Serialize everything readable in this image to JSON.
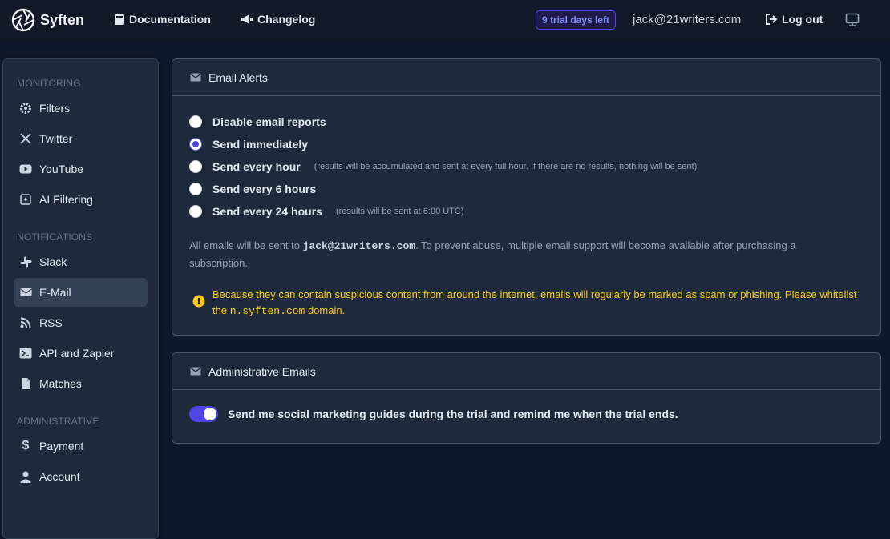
{
  "topbar": {
    "brand": "Syften",
    "nav": [
      {
        "label": "Documentation",
        "icon": "book-icon"
      },
      {
        "label": "Changelog",
        "icon": "announce-icon"
      }
    ],
    "trial_badge": "9 trial days left",
    "user_email": "jack@21writers.com",
    "logout_label": "Log out"
  },
  "sidebar": {
    "sections": {
      "monitoring": "MONITORING",
      "notifications": "NOTIFICATIONS",
      "administrative": "ADMINISTRATIVE"
    },
    "items": [
      {
        "label": "Filters",
        "icon": "gear-icon"
      },
      {
        "label": "Twitter",
        "icon": "x-logo-icon"
      },
      {
        "label": "YouTube",
        "icon": "youtube-icon"
      },
      {
        "label": "AI Filtering",
        "icon": "ai-chip-icon"
      },
      {
        "label": "Slack",
        "icon": "slack-icon"
      },
      {
        "label": "E-Mail",
        "icon": "envelope-icon",
        "active": true
      },
      {
        "label": "RSS",
        "icon": "rss-icon"
      },
      {
        "label": "API and Zapier",
        "icon": "code-icon"
      },
      {
        "label": "Matches",
        "icon": "file-icon"
      },
      {
        "label": "Payment",
        "icon": "dollar-icon"
      },
      {
        "label": "Account",
        "icon": "user-icon"
      }
    ]
  },
  "email_alerts": {
    "title": "Email Alerts",
    "options": [
      {
        "label": "Disable email reports",
        "note": "",
        "checked": false
      },
      {
        "label": "Send immediately",
        "note": "",
        "checked": true
      },
      {
        "label": "Send every hour",
        "note": "(results will be accumulated and sent at every full hour. If there are no results, nothing will be sent)",
        "checked": false
      },
      {
        "label": "Send every 6 hours",
        "note": "",
        "checked": false
      },
      {
        "label": "Send every 24 hours",
        "note": "(results will be sent at 6:00 UTC)",
        "checked": false
      }
    ],
    "info_prefix": "All emails will be sent to",
    "info_email": "jack@21writers.com",
    "info_suffix": ". To prevent abuse, multiple email support will become available after purchasing a subscription.",
    "warning_prefix": "Because they can contain suspicious content from around the internet, emails will regularly be marked as spam or phishing. Please whitelist the",
    "warning_domain": "n.syften.com",
    "warning_suffix": "domain."
  },
  "admin_emails": {
    "title": "Administrative Emails",
    "toggle_label": "Send me social marketing guides during the trial and remind me when the trial ends.",
    "toggle_on": true
  },
  "colors": {
    "accent": "#4f46e5",
    "warning": "#facc15",
    "background": "#0f172a",
    "panel": "#1e293b"
  }
}
